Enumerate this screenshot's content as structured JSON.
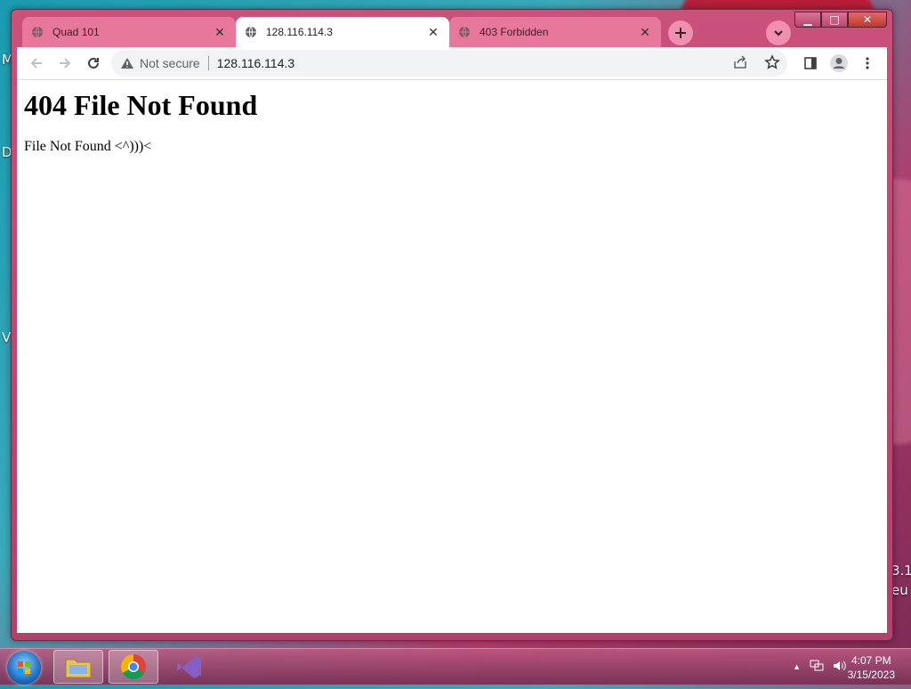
{
  "desktop": {
    "frag_m": "M",
    "frag_d": "D",
    "frag_v": "V",
    "frag_31": "3.1",
    "frag_eu": "eu"
  },
  "window_controls": {
    "minimize": "▁",
    "maximize": "□",
    "close": "✕"
  },
  "tabs": [
    {
      "title": "Quad 101",
      "active": false,
      "icon": "globe-icon"
    },
    {
      "title": "128.116.114.3",
      "active": true,
      "icon": "globe-icon"
    },
    {
      "title": "403 Forbidden",
      "active": false,
      "icon": "globe-icon"
    }
  ],
  "toolbar": {
    "security_status": "Not secure",
    "url": "128.116.114.3"
  },
  "page": {
    "heading": "404 File Not Found",
    "body": "File Not Found <^)))<"
  },
  "taskbar": {
    "time": "4:07 PM",
    "date": "3/15/2023",
    "tray_arrow": "▲"
  },
  "colors": {
    "window_frame": "#c9517a",
    "tab_inactive": "#e8779c",
    "tab_active": "#ffffff"
  }
}
